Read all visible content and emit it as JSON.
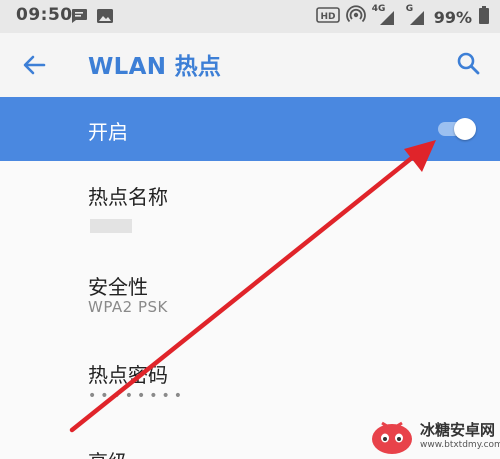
{
  "status_bar": {
    "time": "09:50",
    "left_icons": [
      "message-icon",
      "image-icon"
    ],
    "right_icons": [
      "hd-icon",
      "hotspot-icon",
      "signal-4g-icon",
      "signal-g-icon",
      "battery-icon"
    ],
    "network_4g": "4G",
    "network_g": "G",
    "battery": "99%"
  },
  "app_bar": {
    "title": "WLAN 热点",
    "back_icon": "arrow-back-icon",
    "search_icon": "search-icon"
  },
  "enable": {
    "label": "开启",
    "on": true,
    "accent": "#4a88e0"
  },
  "settings": {
    "hotspot_name": {
      "title": "热点名称"
    },
    "security": {
      "title": "安全性",
      "value": "WPA2 PSK"
    },
    "password": {
      "title": "热点密码",
      "value": "••••••••"
    },
    "advanced": {
      "title": "高级"
    }
  },
  "watermark": {
    "text": "冰糖安卓网",
    "url": "www.btxtdmy.com"
  },
  "colors": {
    "title_blue": "#3d7fd6",
    "annotation_arrow": "#e0242a"
  }
}
